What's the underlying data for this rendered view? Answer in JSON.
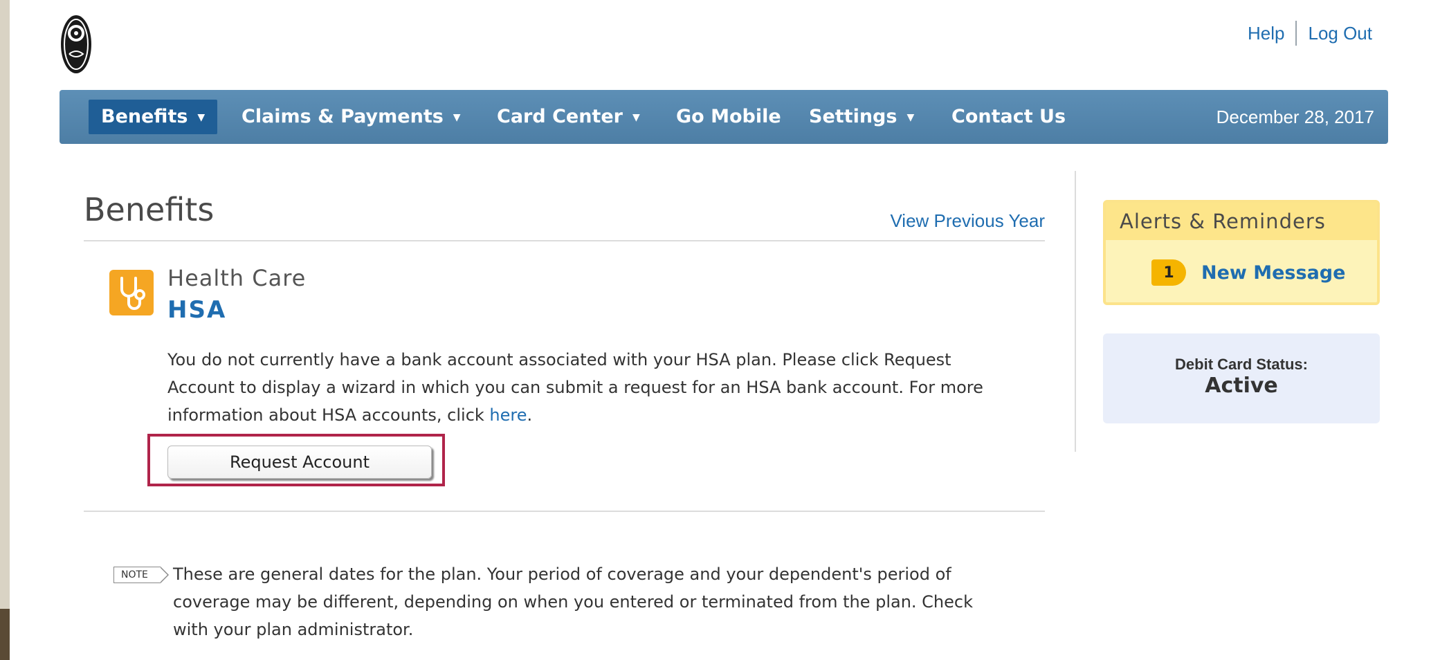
{
  "header": {
    "help_label": "Help",
    "logout_label": "Log Out"
  },
  "nav": {
    "items": [
      {
        "label": "Benefits",
        "dropdown": true,
        "active": true
      },
      {
        "label": "Claims & Payments",
        "dropdown": true
      },
      {
        "label": "Card Center",
        "dropdown": true
      },
      {
        "label": "Go Mobile",
        "dropdown": false
      },
      {
        "label": "Settings",
        "dropdown": true
      },
      {
        "label": "Contact Us",
        "dropdown": false
      }
    ],
    "date": "December 28, 2017",
    "colors": {
      "bar": "#5589b0",
      "active": "#1f5e96"
    }
  },
  "main": {
    "title": "Benefits",
    "view_previous_label": "View Previous Year",
    "plan": {
      "icon": "stethoscope-icon",
      "category": "Health Care",
      "name": "HSA",
      "description_text": "You do not currently have a bank account associated with your HSA plan. Please click Request Account to display a wizard in which you can submit a request for an HSA bank account. For more information about HSA accounts, click ",
      "description_link": "here",
      "description_end": ".",
      "button_label": "Request Account"
    },
    "note": {
      "tag": "NOTE",
      "text": "These are general dates for the plan. Your period of coverage and your dependent's period of coverage may be different, depending on when you entered or terminated from the plan. Check with your plan administrator."
    }
  },
  "sidebar": {
    "alerts": {
      "title": "Alerts & Reminders",
      "count": "1",
      "message_label": "New Message"
    },
    "debit_card": {
      "label": "Debit Card Status:",
      "value": "Active"
    }
  },
  "colors": {
    "link": "#1f6db0",
    "highlight": "#b0244a",
    "alerts_bg": "#fdf3b9",
    "debit_bg": "#e9eefa",
    "icon_orange": "#f5a623"
  }
}
